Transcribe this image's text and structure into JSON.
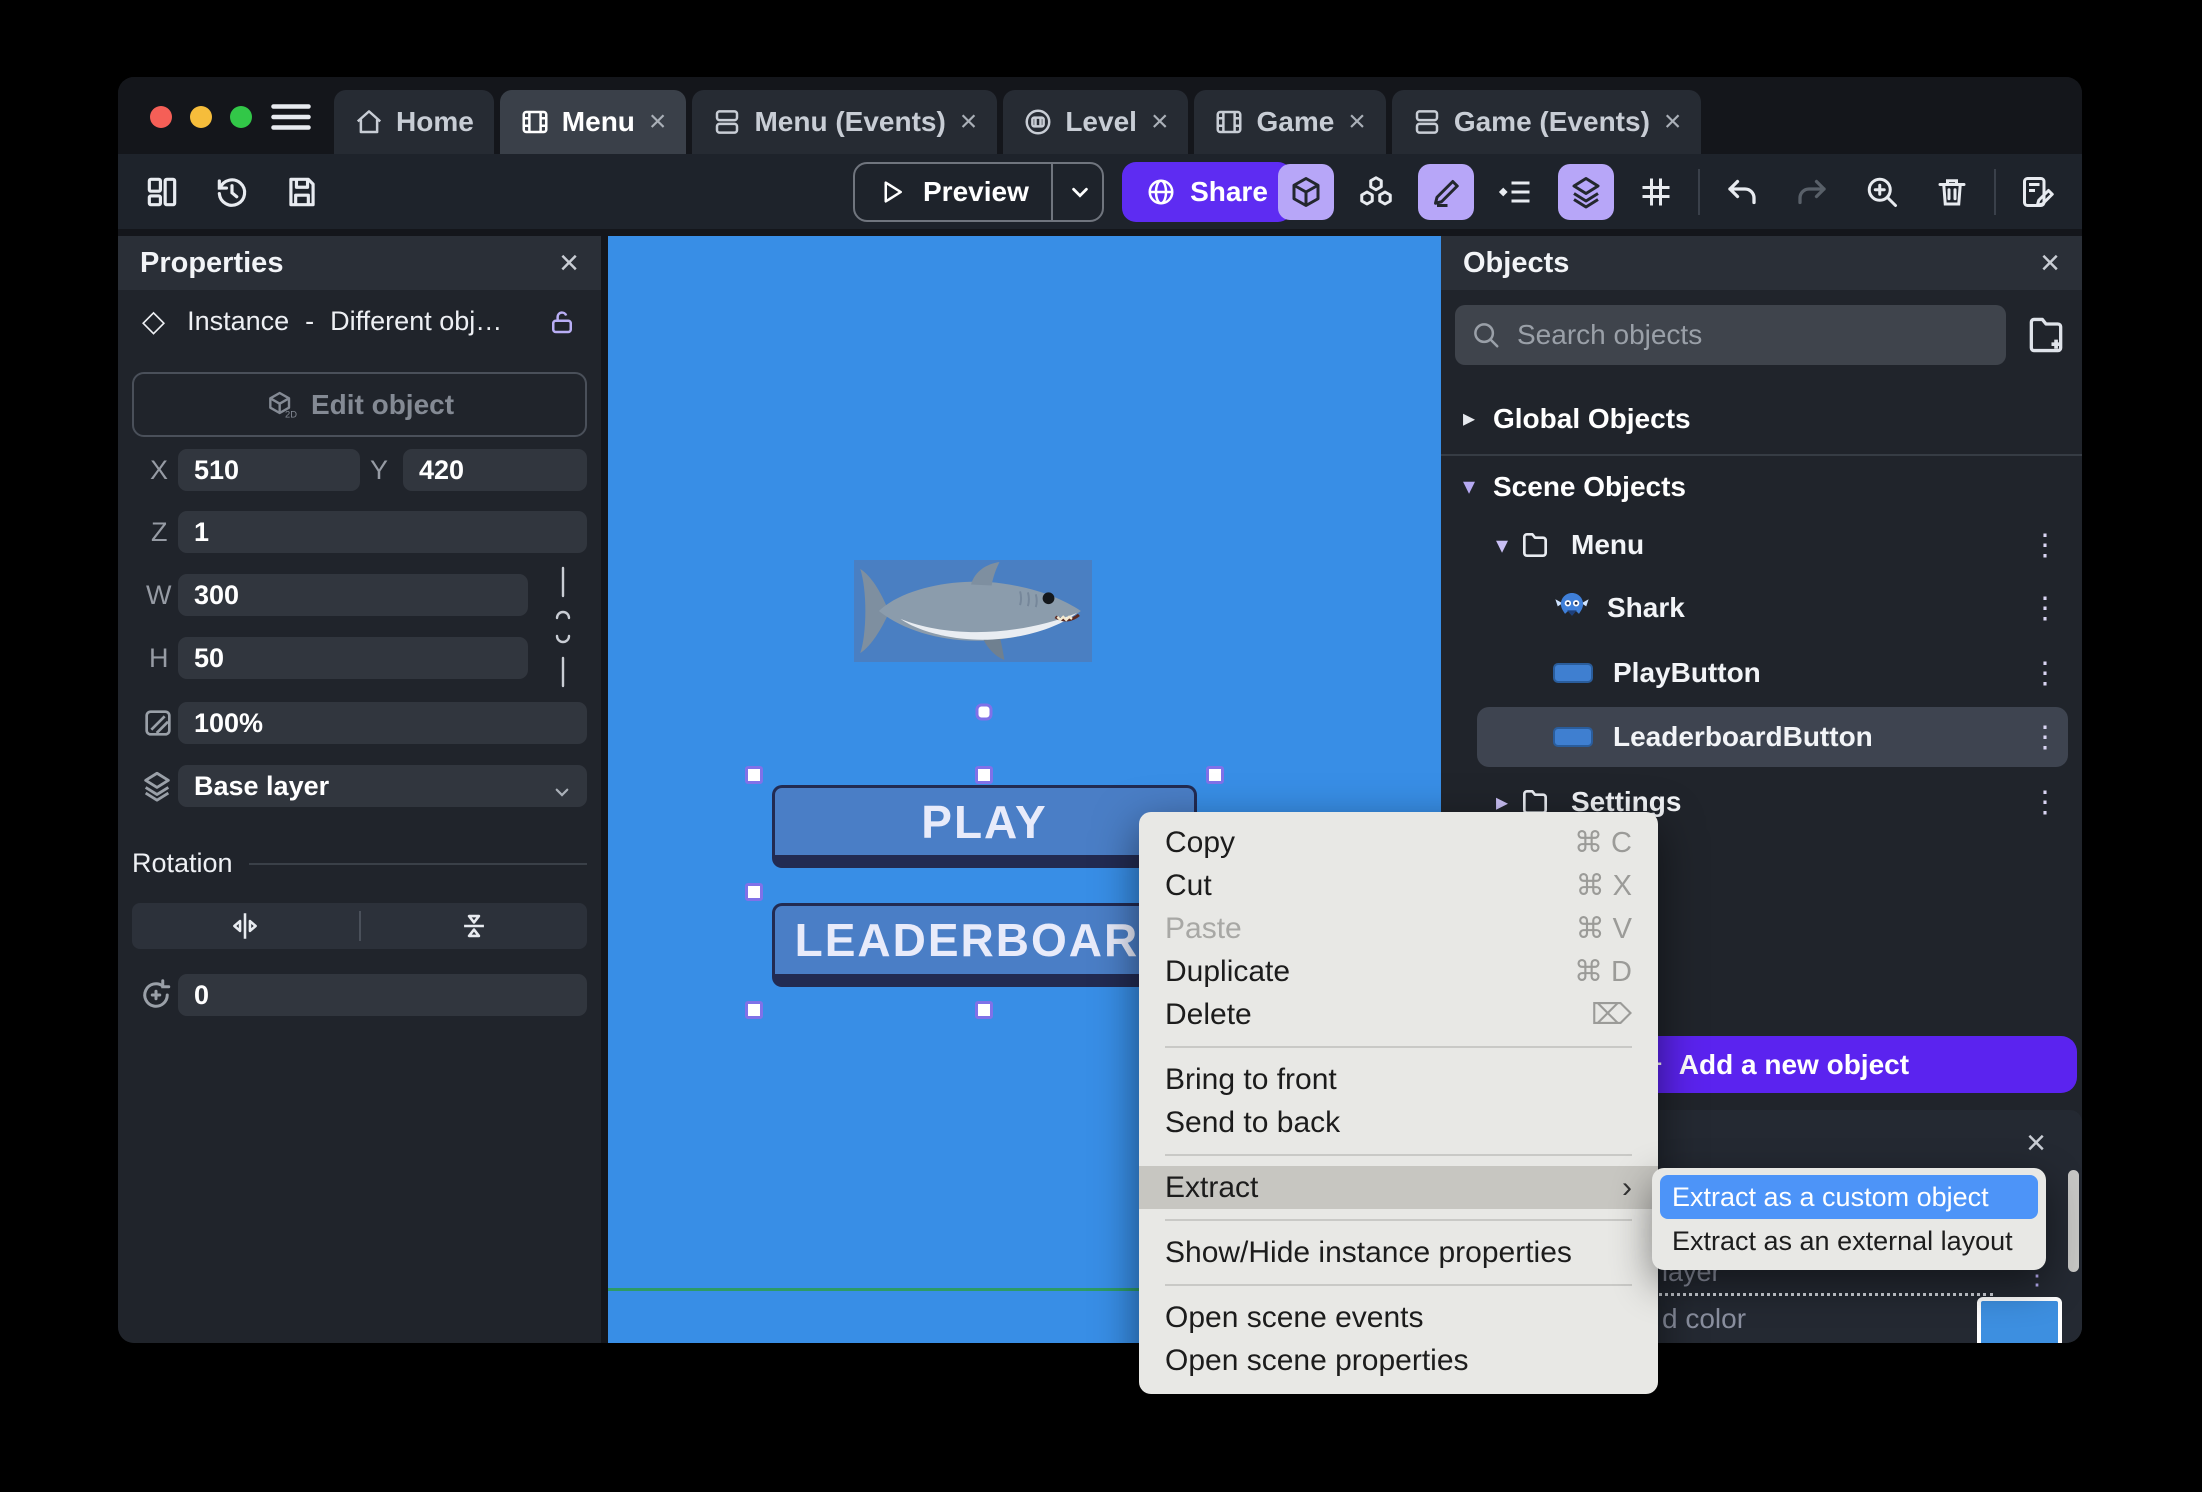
{
  "tabs": [
    {
      "label": "Home",
      "icon": "home-icon",
      "closable": false,
      "active": false
    },
    {
      "label": "Menu",
      "icon": "film-icon",
      "closable": true,
      "active": true
    },
    {
      "label": "Menu (Events)",
      "icon": "events-icon",
      "closable": true,
      "active": false
    },
    {
      "label": "Level",
      "icon": "level-icon",
      "closable": true,
      "active": false
    },
    {
      "label": "Game",
      "icon": "film-icon",
      "closable": true,
      "active": false
    },
    {
      "label": "Game (Events)",
      "icon": "events-icon",
      "closable": true,
      "active": false
    }
  ],
  "toolbar": {
    "preview_label": "Preview",
    "share_label": "Share"
  },
  "properties": {
    "title": "Properties",
    "close_glyph": "×",
    "instance_kind": "Instance",
    "separator": "-",
    "instance_object": "Different obj…",
    "edit_object_label": "Edit object",
    "x_label": "X",
    "x_value": "510",
    "y_label": "Y",
    "y_value": "420",
    "z_label": "Z",
    "z_value": "1",
    "w_label": "W",
    "w_value": "300",
    "h_label": "H",
    "h_value": "50",
    "opacity_value": "100%",
    "layer_value": "Base layer",
    "rotation_title": "Rotation",
    "angle_value": "0"
  },
  "canvas": {
    "play_label": "PLAY",
    "leaderboard_label": "LEADERBOARD"
  },
  "objects": {
    "title": "Objects",
    "close_glyph": "×",
    "search_placeholder": "Search objects",
    "global_header": "Global Objects",
    "scene_header": "Scene Objects",
    "items": [
      {
        "name": "Menu",
        "type": "folder",
        "expanded": true
      },
      {
        "name": "Shark",
        "type": "sprite"
      },
      {
        "name": "PlayButton",
        "type": "button"
      },
      {
        "name": "LeaderboardButton",
        "type": "button",
        "selected": true
      },
      {
        "name": "Settings",
        "type": "folder",
        "expanded": false
      }
    ],
    "menu_dots_glyph": "⋮",
    "add_button_label": "Add a new object",
    "add_button_plus": "+"
  },
  "layers_panel": {
    "close_glyph": "×",
    "layer_text_visible": "layer",
    "color_text_visible": "d color",
    "dots_glyph": "⋮"
  },
  "context_menu": {
    "items": [
      {
        "label": "Copy",
        "shortcut": "⌘ C"
      },
      {
        "label": "Cut",
        "shortcut": "⌘ X"
      },
      {
        "label": "Paste",
        "shortcut": "⌘ V",
        "disabled": true
      },
      {
        "label": "Duplicate",
        "shortcut": "⌘ D"
      },
      {
        "label": "Delete",
        "shortcut": "⌦"
      },
      {
        "label": "Bring to front"
      },
      {
        "label": "Send to back"
      },
      {
        "label": "Extract",
        "has_submenu": true,
        "highlighted": true,
        "arrow": "›"
      },
      {
        "label": "Show/Hide instance properties"
      },
      {
        "label": "Open scene events"
      },
      {
        "label": "Open scene properties"
      }
    ]
  },
  "submenu": {
    "items": [
      {
        "label": "Extract as a custom object",
        "highlighted": true
      },
      {
        "label": "Extract as an external layout"
      }
    ]
  },
  "colors": {
    "canvas_blue": "#388ee6",
    "accent_purple": "#5e2cf2",
    "toolbar_active_purple": "#b7a6f8",
    "submenu_highlight_blue": "#4d94f8",
    "background_color_swatch": "#3d8fe0",
    "selection_handle_purple": "#8071e8"
  }
}
